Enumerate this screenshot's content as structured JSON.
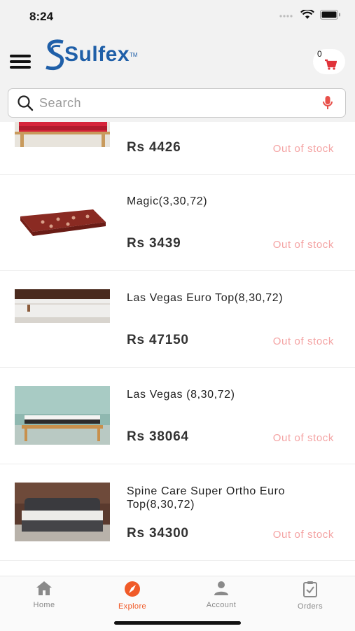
{
  "status_bar": {
    "time": "8:24"
  },
  "header": {
    "logo_text": "Sulfex",
    "logo_tm": "TM",
    "cart_count": "0"
  },
  "search": {
    "placeholder": "Search"
  },
  "products": [
    {
      "name": "",
      "price": "Rs 4426",
      "stock": "Out of stock"
    },
    {
      "name": "Magic(3,30,72)",
      "price": "Rs 3439",
      "stock": "Out of stock"
    },
    {
      "name": "Las Vegas Euro Top(8,30,72)",
      "price": "Rs 47150",
      "stock": "Out of stock"
    },
    {
      "name": "Las Vegas (8,30,72)",
      "price": "Rs 38064",
      "stock": "Out of stock"
    },
    {
      "name": "Spine Care Super Ortho Euro Top(8,30,72)",
      "price": "Rs 34300",
      "stock": "Out of stock"
    }
  ],
  "tabs": [
    {
      "label": "Home",
      "icon": "home-icon"
    },
    {
      "label": "Explore",
      "icon": "compass-icon",
      "active": true
    },
    {
      "label": "Account",
      "icon": "person-icon"
    },
    {
      "label": "Orders",
      "icon": "clipboard-check-icon"
    }
  ],
  "colors": {
    "accent": "#f05a28",
    "brand": "#1f5fa8",
    "out_of_stock": "#f4a3a3"
  }
}
